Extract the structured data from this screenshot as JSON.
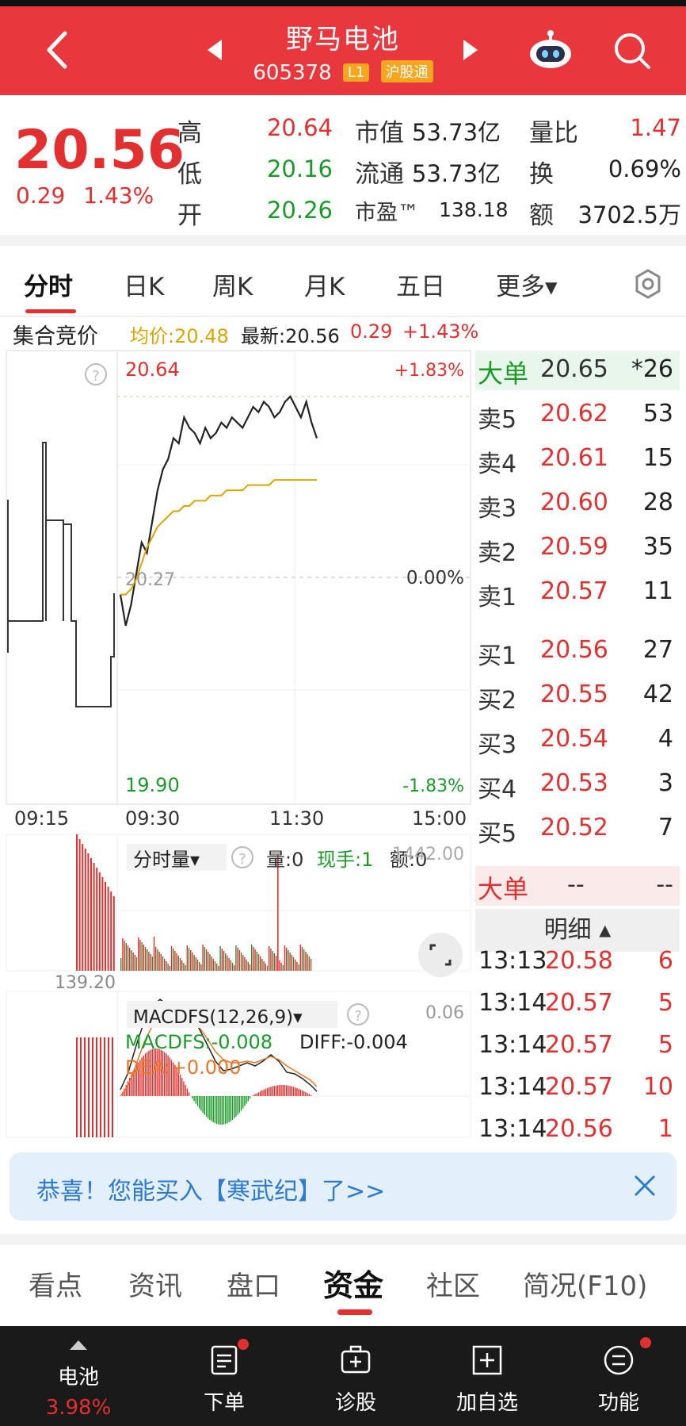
{
  "header": {
    "title": "野马电池",
    "code": "605378",
    "tag_l1": "L1",
    "tag_connect": "沪股通",
    "bg_color": "#e8383d",
    "icons": [
      "back-icon",
      "prev-stock-icon",
      "next-stock-icon",
      "robot-assistant-icon",
      "search-icon"
    ]
  },
  "quote": {
    "price": "20.56",
    "change": "0.29",
    "change_pct": "1.43%",
    "high_label": "高",
    "high": "20.64",
    "low_label": "低",
    "low": "20.16",
    "open_label": "开",
    "open": "20.26",
    "mcap_label": "市值",
    "mcap": "53.73亿",
    "float_label": "流通",
    "float": "53.73亿",
    "pe_label": "市盈™",
    "pe": "138.18",
    "vr_label": "量比",
    "vr": "1.47",
    "turnover_label": "换",
    "turnover": "0.69%",
    "amount_label": "额",
    "amount": "3702.5万"
  },
  "tabs": {
    "items": [
      "分时",
      "日K",
      "周K",
      "月K",
      "五日",
      "更多▾"
    ],
    "active": "分时"
  },
  "chart_info": {
    "auction_label": "集合竞价",
    "avg_label": "均价:20.48",
    "latest_label": "最新:20.56",
    "chg": "0.29",
    "chg_pct": "+1.43%"
  },
  "chart_data": {
    "type": "line",
    "price_high": "20.64",
    "price_low": "19.90",
    "pct_high": "+1.83%",
    "pct_low": "-1.83%",
    "pct_mid": "0.00%",
    "prev_close": "20.27",
    "x_ticks": [
      "09:15",
      "09:30",
      "11:30",
      "15:00"
    ],
    "ylim": [
      19.9,
      20.64
    ],
    "series": [
      {
        "values": [
          20.26,
          20.2,
          20.24,
          20.3,
          20.36,
          20.34,
          20.4,
          20.46,
          20.5,
          20.52,
          20.56,
          20.55,
          20.6,
          20.58,
          20.57,
          20.55,
          20.58,
          20.56,
          20.57,
          20.59,
          20.58,
          20.6,
          20.59,
          20.58,
          20.6,
          20.62,
          20.61,
          20.63,
          20.62,
          20.6,
          20.61,
          20.63,
          20.64,
          20.62,
          20.6,
          20.63,
          20.59,
          20.56
        ]
      },
      {
        "values": [
          20.26,
          20.26,
          20.27,
          20.29,
          20.32,
          20.35,
          20.37,
          20.39,
          20.4,
          20.41,
          20.42,
          20.42,
          20.43,
          20.43,
          20.44,
          20.44,
          20.44,
          20.45,
          20.45,
          20.45,
          20.46,
          20.46,
          20.46,
          20.46,
          20.47,
          20.47,
          20.47,
          20.47,
          20.47,
          20.48,
          20.48,
          20.48,
          20.48,
          20.48,
          20.48,
          20.48,
          20.48,
          20.48
        ]
      }
    ],
    "volume_panel": {
      "label": "分时量▾",
      "vol": "量:0",
      "now_hand": "现手:1",
      "amount": "额:0",
      "max": "1442.00",
      "level": "139.20"
    },
    "macd_panel": {
      "label": "MACDFS(12,26,9)▾",
      "macd": "MACDFS:-0.008",
      "diff": "DIFF:-0.004",
      "dea": "DEA:+0.000",
      "max": "0.06"
    }
  },
  "orderbook": {
    "big_top_label": "大单",
    "big_top_price": "20.65",
    "big_top_vol": "*26",
    "asks": [
      {
        "label": "卖5",
        "price": "20.62",
        "vol": "53"
      },
      {
        "label": "卖4",
        "price": "20.61",
        "vol": "15"
      },
      {
        "label": "卖3",
        "price": "20.60",
        "vol": "28"
      },
      {
        "label": "卖2",
        "price": "20.59",
        "vol": "35"
      },
      {
        "label": "卖1",
        "price": "20.57",
        "vol": "11"
      }
    ],
    "bids": [
      {
        "label": "买1",
        "price": "20.56",
        "vol": "27"
      },
      {
        "label": "买2",
        "price": "20.55",
        "vol": "42"
      },
      {
        "label": "买3",
        "price": "20.54",
        "vol": "4"
      },
      {
        "label": "买4",
        "price": "20.53",
        "vol": "3"
      },
      {
        "label": "买5",
        "price": "20.52",
        "vol": "7"
      }
    ],
    "big_bottom_label": "大单",
    "big_bottom_price": "--",
    "big_bottom_vol": "--",
    "detail_label": "明细 ▴",
    "ticks": [
      {
        "time": "13:13",
        "price": "20.58",
        "vol": "6"
      },
      {
        "time": "13:14",
        "price": "20.57",
        "vol": "5"
      },
      {
        "time": "13:14",
        "price": "20.57",
        "vol": "5"
      },
      {
        "time": "13:14",
        "price": "20.57",
        "vol": "10"
      },
      {
        "time": "13:14",
        "price": "20.56",
        "vol": "1"
      }
    ]
  },
  "banner": {
    "text": "恭喜！您能买入【寒武纪】了>>"
  },
  "bottom_tabs": {
    "items": [
      "看点",
      "资讯",
      "盘口",
      "资金",
      "社区",
      "简况(F10)"
    ],
    "active": "资金"
  },
  "bottom_nav": {
    "sector_name": "电池",
    "sector_pct": "3.98%",
    "items": [
      "下单",
      "诊股",
      "加自选",
      "功能"
    ]
  },
  "colors": {
    "up": "#e23030",
    "down": "#1b9a2a",
    "accent": "#e8383d",
    "avg_line": "#d9a400"
  }
}
